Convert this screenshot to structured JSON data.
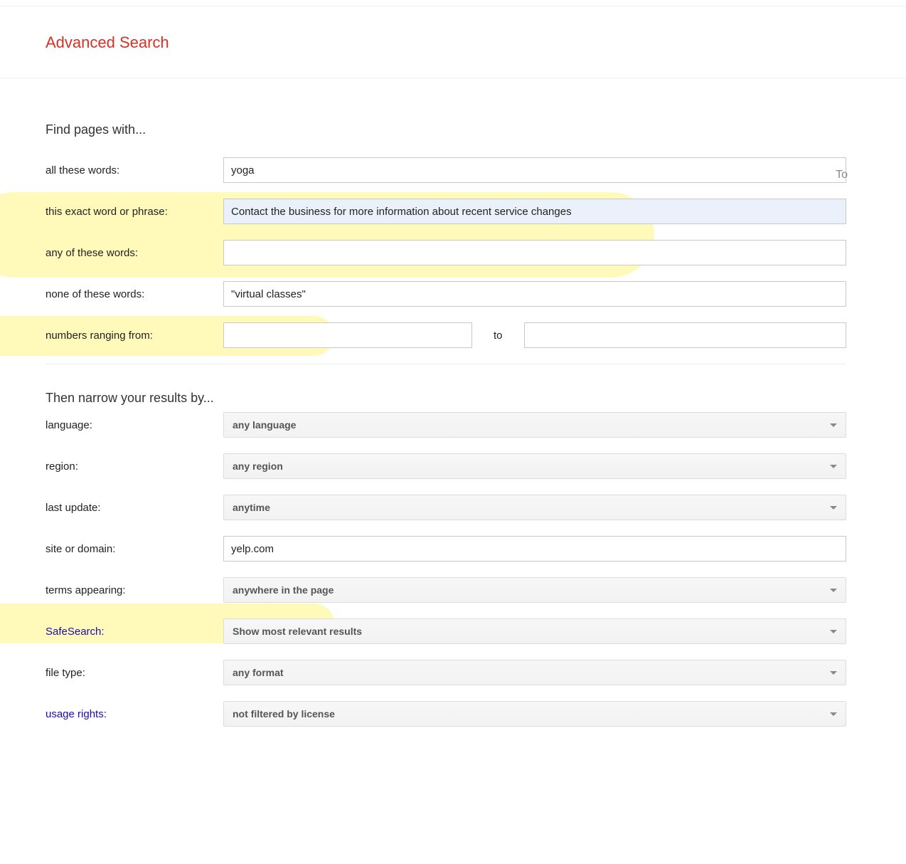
{
  "page": {
    "title": "Advanced Search",
    "edge_text": "To"
  },
  "find": {
    "heading": "Find pages with...",
    "rows": {
      "all_words": {
        "label": "all these words:",
        "value": "yoga"
      },
      "exact": {
        "label": "this exact word or phrase:",
        "value": "Contact the business for more information about recent service changes"
      },
      "any_words": {
        "label": "any of these words:",
        "value": ""
      },
      "none_words": {
        "label": "none of these words:",
        "value": "\"virtual classes\""
      },
      "numbers": {
        "label": "numbers ranging from:",
        "from": "",
        "to_label": "to",
        "to": ""
      }
    }
  },
  "narrow": {
    "heading": "Then narrow your results by...",
    "language": {
      "label": "language:",
      "selected": "any language"
    },
    "region": {
      "label": "region:",
      "selected": "any region"
    },
    "last_update": {
      "label": "last update:",
      "selected": "anytime"
    },
    "site": {
      "label": "site or domain:",
      "value": "yelp.com"
    },
    "terms": {
      "label": "terms appearing:",
      "selected": "anywhere in the page"
    },
    "safesearch": {
      "label": "SafeSearch:",
      "selected": "Show most relevant results"
    },
    "filetype": {
      "label": "file type:",
      "selected": "any format"
    },
    "usage": {
      "label": "usage rights:",
      "selected": "not filtered by license"
    }
  }
}
